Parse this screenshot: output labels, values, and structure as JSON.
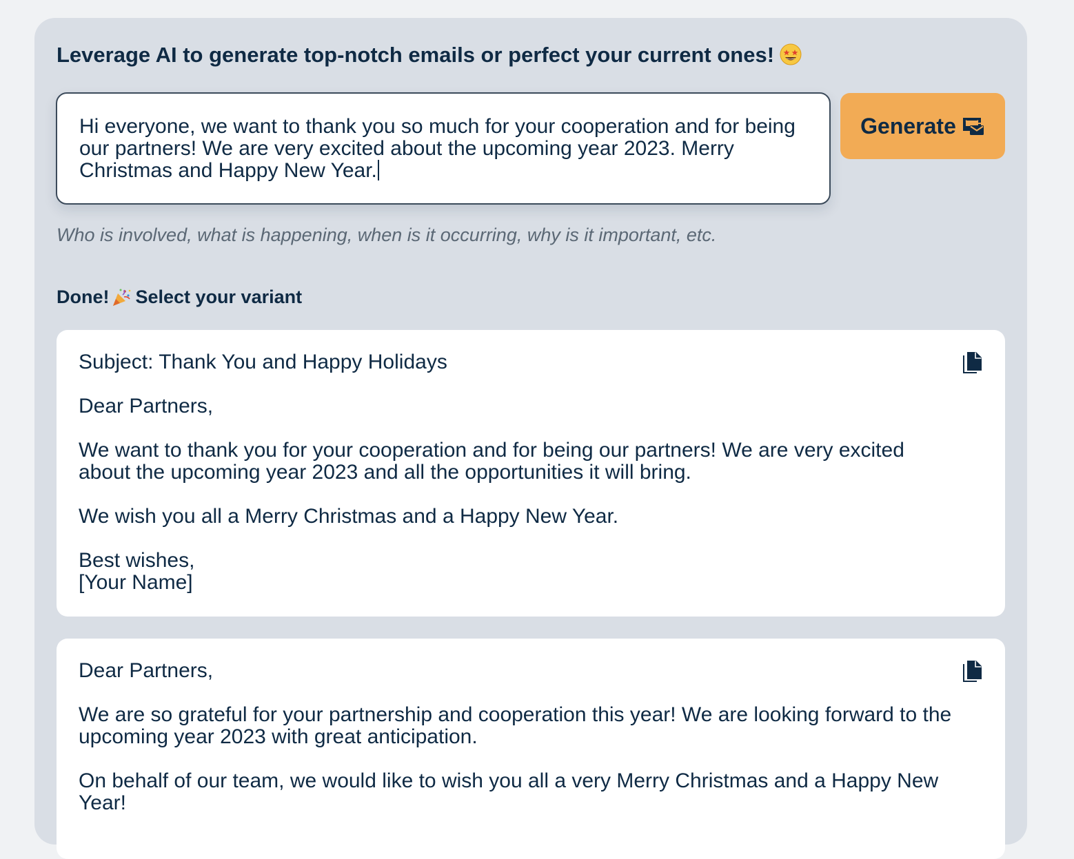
{
  "header": {
    "title": "Leverage AI to generate top-notch emails or perfect your current ones!",
    "title_emoji": "star-struck-emoji"
  },
  "prompt": {
    "value": "Hi everyone, we want to thank you so much for your cooperation and for being our partners! We are very excited about the upcoming year 2023. Merry Christmas and Happy New Year.",
    "hint": "Who is involved, what is happening, when is it occurring, why is it important, etc."
  },
  "generate_button": {
    "label": "Generate",
    "icon": "mail-send-icon",
    "color": "#f2ab55"
  },
  "results": {
    "done_label": "Done!",
    "select_label": "Select your variant",
    "done_emoji": "party-popper-emoji",
    "variants": [
      {
        "text": "Subject: Thank You and Happy Holidays\n\nDear Partners,\n\nWe want to thank you for your cooperation and for being our partners! We are very excited about the upcoming year 2023 and all the opportunities it will bring.\n\nWe wish you all a Merry Christmas and a Happy New Year.\n\nBest wishes,\n[Your Name]",
        "copy_icon": "copy-icon"
      },
      {
        "text": "Dear Partners,\n\nWe are so grateful for your partnership and cooperation this year! We are looking forward to the upcoming year 2023 with great anticipation.\n\nOn behalf of our team, we would like to wish you all a very Merry Christmas and a Happy New Year!",
        "copy_icon": "copy-icon"
      }
    ]
  },
  "colors": {
    "background": "#f0f2f4",
    "panel": "#d9dee5",
    "text": "#0f2a44",
    "accent": "#f2ab55"
  }
}
